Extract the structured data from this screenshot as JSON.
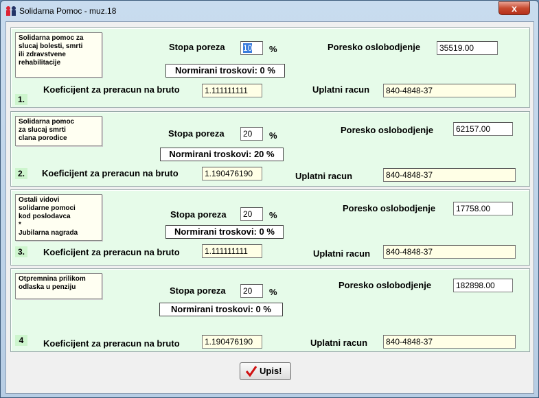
{
  "window": {
    "title": "Solidarna Pomoc - muz.18",
    "close_label": "x"
  },
  "labels": {
    "stopa": "Stopa poreza",
    "percent": "%",
    "oslobodjenje": "Poresko oslobodjenje",
    "koeficijent": "Koeficijent za preracun na bruto",
    "koeficijent4": "Koeficijent  za preracun na bruto",
    "uplatni": "Uplatni racun"
  },
  "panels": [
    {
      "num": "1.",
      "desc": "Solidarna pomoc za\nslucaj bolesti, smrti\nili  zdravstvene\nrehabilitacije",
      "stopa": "10",
      "normirani": "Normirani troskovi: 0 %",
      "oslobodjenje": "35519.00",
      "koeficijent": "1.111111111",
      "racun": "840-4848-37"
    },
    {
      "num": "2.",
      "desc": "Solidarna pomoc\nza slucaj smrti\nclana porodice",
      "stopa": "20",
      "normirani": "Normirani troskovi: 20 %",
      "oslobodjenje": "62157.00",
      "koeficijent": "1.190476190",
      "racun": "840-4848-37"
    },
    {
      "num": "3.",
      "desc": "Ostali vidovi\nsolidarne pomoci\nkod poslodavca\n        *\nJubilarna nagrada",
      "stopa": "20",
      "normirani": "Normirani troskovi: 0 %",
      "oslobodjenje": "17758.00",
      "koeficijent": "1.111111111",
      "racun": "840-4848-37"
    },
    {
      "num": "4",
      "desc": " Otpremnina prilikom\n   odlaska u penziju",
      "stopa": "20",
      "normirani": "Normirani troskovi: 0 %",
      "oslobodjenje": "182898.00",
      "koeficijent": "1.190476190",
      "racun": "840-4848-37"
    }
  ],
  "buttons": {
    "upis": "Upis!"
  }
}
